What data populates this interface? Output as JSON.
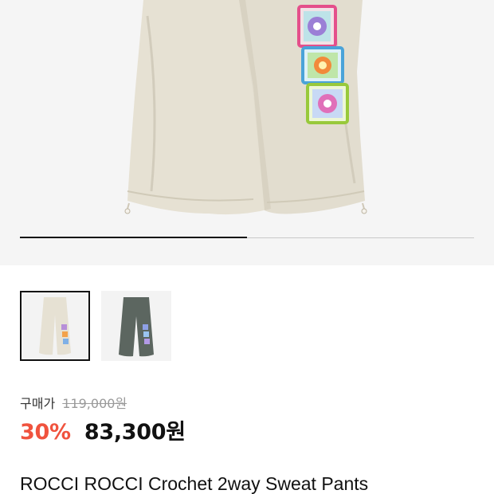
{
  "gallery": {
    "progress": 0.5,
    "main_image_alt": "cream wide sweat pants with crochet flower patches",
    "thumbnails": [
      {
        "color_name": "cream",
        "selected": true
      },
      {
        "color_name": "charcoal-green",
        "selected": false
      }
    ]
  },
  "pricing": {
    "purchase_label": "구매가",
    "original_price": "119,000원",
    "discount_rate": "30%",
    "final_price": "83,300원"
  },
  "product": {
    "title": "ROCCI ROCCI Crochet 2way Sweat Pants"
  },
  "colors": {
    "discount": "#f0533e",
    "pants_cream": "#e5e0d2",
    "pants_charcoal": "#5c6660",
    "progress_active": "#111111"
  }
}
